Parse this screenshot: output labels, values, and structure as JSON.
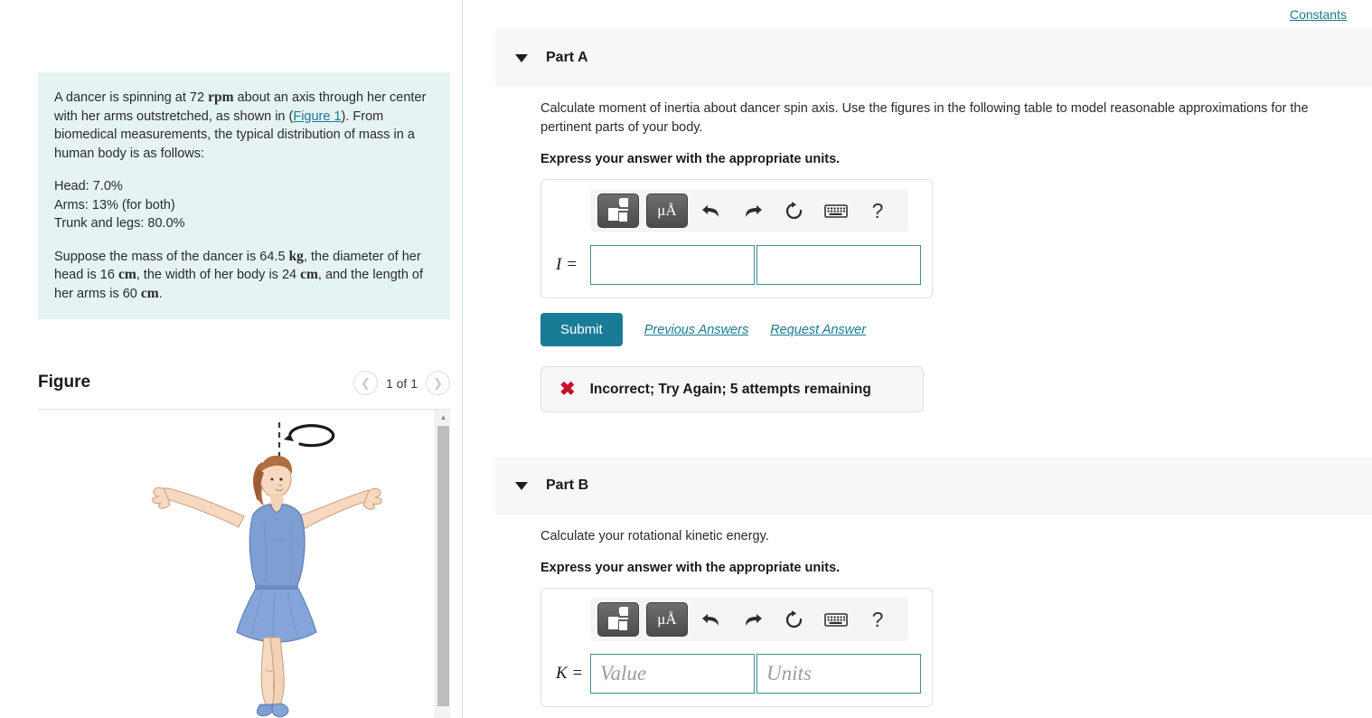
{
  "problem": {
    "para1_a": "A dancer is spinning at 72 ",
    "para1_rpm": "rpm",
    "para1_b": " about an axis through her center with her arms outstretched, as shown in (",
    "figure_link": "Figure 1",
    "para1_c": "). From biomedical measurements, the typical distribution of mass in a human body is as follows:",
    "dist_head": "Head: 7.0%",
    "dist_arms": "Arms: 13% (for both)",
    "dist_trunk": "Trunk and legs: 80.0%",
    "para3_a": "Suppose the mass of the dancer is 64.5 ",
    "para3_kg": "kg",
    "para3_b": ", the diameter of her head is 16 ",
    "para3_cm1": "cm",
    "para3_c": ", the width of her body is 24 ",
    "para3_cm2": "cm",
    "para3_d": ", and the length of her arms is 60 ",
    "para3_cm3": "cm",
    "para3_e": "."
  },
  "figure_panel": {
    "title": "Figure",
    "counter": "1 of 1",
    "prev_icon": "❮",
    "next_icon": "❯",
    "scroll_up_icon": "▲"
  },
  "header": {
    "constants_label": "Constants"
  },
  "toolbar": {
    "template_icon": "math-template-icon",
    "units_label": "μÅ",
    "undo_icon": "↩",
    "redo_icon": "↪",
    "reset_icon": "↻",
    "keyboard_icon": "⌨",
    "help_icon": "?"
  },
  "parts": [
    {
      "title": "Part A",
      "prompt": "Calculate moment of inertia about dancer spin axis. Use the figures in the following table to model reasonable approximations for the pertinent parts of your body.",
      "instruction": "Express your answer with the appropriate units.",
      "answer_label": "I =",
      "value": "",
      "units": "",
      "value_placeholder": "",
      "units_placeholder": "",
      "submit_label": "Submit",
      "previous_answers_label": "Previous Answers",
      "request_answer_label": "Request Answer",
      "feedback_icon": "✖",
      "feedback_text": "Incorrect; Try Again; 5 attempts remaining"
    },
    {
      "title": "Part B",
      "prompt": "Calculate your rotational kinetic energy.",
      "instruction": "Express your answer with the appropriate units.",
      "answer_label": "K =",
      "value": "",
      "units": "",
      "value_placeholder": "Value",
      "units_placeholder": "Units"
    }
  ],
  "colors": {
    "accent_teal": "#1a7b96",
    "link_teal": "#1a7a93",
    "problem_bg": "#e6f3f3",
    "header_bg": "#f7f7f7",
    "error_red": "#c8102e",
    "field_border": "#3f8e95"
  }
}
